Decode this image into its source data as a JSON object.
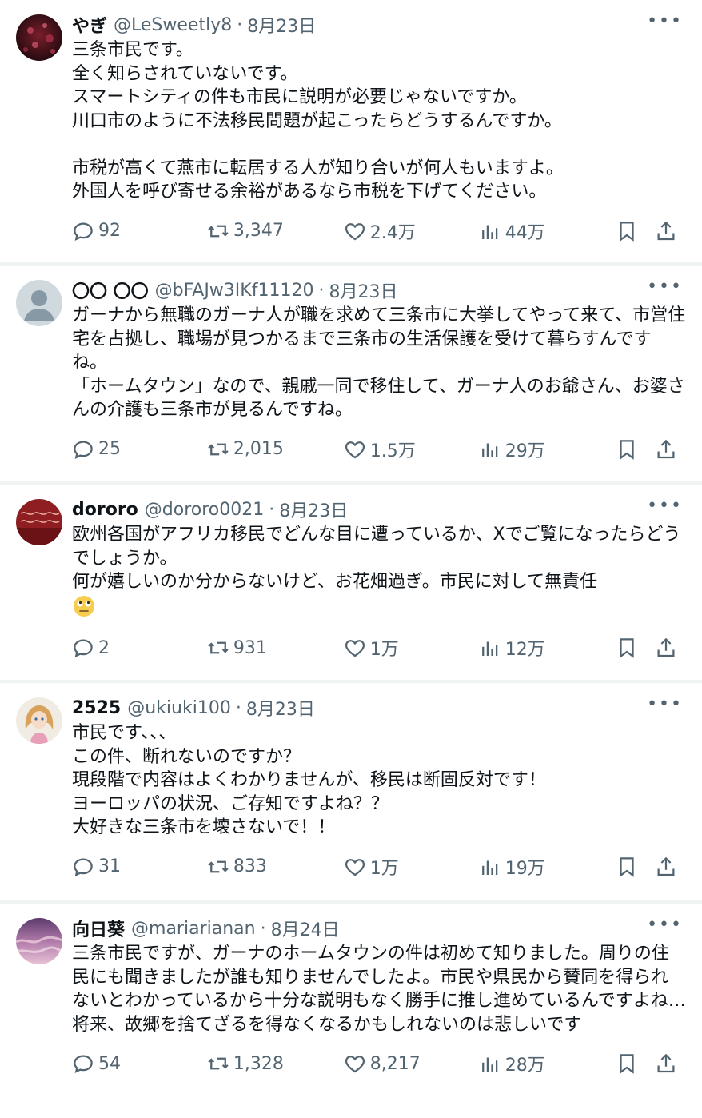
{
  "colors": {
    "text": "#0f1419",
    "muted": "#536471",
    "divider": "#eff3f4"
  },
  "tweets": [
    {
      "name": "やぎ",
      "handle": "@LeSweetly8",
      "date": "8月23日",
      "avatar": "dark-red-bokeh",
      "text": "三条市民です。\n全く知らされていないです。\nスマートシティの件も市民に説明が必要じゃないですか。\n川口市のように不法移民問題が起こったらどうするんですか。\n\n市税が高くて燕市に転居する人が知り合いが何人もいますよ。\n外国人を呼び寄せる余裕があるなら市税を下げてください。",
      "replies": "92",
      "reposts": "3,347",
      "likes": "2.4万",
      "views": "44万"
    },
    {
      "name": "〇〇 〇〇",
      "handle": "@bFAJw3IKf11120",
      "date": "8月23日",
      "avatar": "default-gray",
      "text": "ガーナから無職のガーナ人が職を求めて三条市に大挙してやって来て、市営住宅を占拠し、職場が見つかるまで三条市の生活保護を受けて暮らすんですね。\n「ホームタウン」なので、親戚一同で移住して、ガーナ人のお爺さん、お婆さんの介護も三条市が見るんですね。",
      "replies": "25",
      "reposts": "2,015",
      "likes": "1.5万",
      "views": "29万"
    },
    {
      "name": "dororo",
      "handle": "@dororo0021",
      "date": "8月23日",
      "avatar": "red-pattern",
      "text": "欧州各国がアフリカ移民でどんな目に遭っているか、Xでご覧になったらどうでしょうか。\n何が嬉しいのか分からないけど、お花畑過ぎ。市民に対して無責任",
      "emoji": "face-with-rolling-eyes",
      "replies": "2",
      "reposts": "931",
      "likes": "1万",
      "views": "12万"
    },
    {
      "name": "2525",
      "handle": "@ukiuki100",
      "date": "8月23日",
      "avatar": "doll",
      "text": "市民です、、、\nこの件、断れないのですか？\n現段階で内容はよくわかりませんが、移民は断固反対です！\nヨーロッパの状況、ご存知ですよね？？\n大好きな三条市を壊さないで！！",
      "replies": "31",
      "reposts": "833",
      "likes": "1万",
      "views": "19万"
    },
    {
      "name": "向日葵",
      "handle": "@mariarianan",
      "date": "8月24日",
      "avatar": "purple-sky",
      "text": "三条市民ですが、ガーナのホームタウンの件は初めて知りました。周りの住民にも聞きましたが誰も知りませんでしたよ。市民や県民から賛同を得られないとわかっているから十分な説明もなく勝手に推し進めているんですよね…\n将来、故郷を捨てざるを得なくなるかもしれないのは悲しいです",
      "replies": "54",
      "reposts": "1,328",
      "likes": "8,217",
      "views": "28万"
    }
  ]
}
